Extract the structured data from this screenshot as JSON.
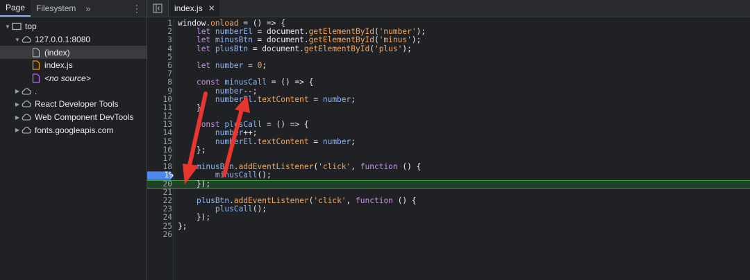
{
  "left_panel": {
    "tabs": [
      {
        "label": "Page",
        "active": true
      },
      {
        "label": "Filesystem",
        "active": false
      }
    ],
    "more_tabs": "»",
    "tree": [
      {
        "label": "top",
        "indent": 0,
        "expanded": true,
        "icon": "frame-icon"
      },
      {
        "label": "127.0.0.1:8080",
        "indent": 1,
        "expanded": true,
        "icon": "cloud-icon"
      },
      {
        "label": "(index)",
        "indent": 2,
        "icon": "file-icon",
        "selected": true
      },
      {
        "label": "index.js",
        "indent": 2,
        "icon": "js-file-icon"
      },
      {
        "label": "<no source>",
        "indent": 2,
        "icon": "snippet-file-icon",
        "italic": true
      },
      {
        "label": ".",
        "indent": 1,
        "expanded": false,
        "icon": "cloud-icon"
      },
      {
        "label": "React Developer Tools",
        "indent": 1,
        "expanded": false,
        "icon": "cloud-icon"
      },
      {
        "label": "Web Component DevTools",
        "indent": 1,
        "expanded": false,
        "icon": "cloud-icon"
      },
      {
        "label": "fonts.googleapis.com",
        "indent": 1,
        "expanded": false,
        "icon": "cloud-icon"
      }
    ]
  },
  "editor": {
    "open_file": "index.js",
    "close_glyph": "✕",
    "breakpoint_line": 19,
    "current_line": 20,
    "lines": [
      "window.onload = () => {",
      "    let numberEl = document.getElementById('number');",
      "    let minusBtn = document.getElementById('minus');",
      "    let plusBtn = document.getElementById('plus');",
      "",
      "    let number = 0;",
      "",
      "    const minusCall = () => {",
      "        number--;",
      "        numberEl.textContent = number;",
      "    };",
      "",
      "    const plusCall = () => {",
      "        number++;",
      "        numberEl.textContent = number;",
      "    };",
      "",
      "    minusBtn.addEventListener('click', function () {",
      "        minusCall();",
      "    });",
      "",
      "    plusBtn.addEventListener('click', function () {",
      "        plusCall();",
      "    });",
      "};",
      ""
    ]
  },
  "colors": {
    "accent": "#8ab4f8",
    "breakpoint": "#4d87ef",
    "current_line_bg": "#1f4226",
    "current_line_border": "#3fa142",
    "annotation_arrow": "#e8352e"
  }
}
